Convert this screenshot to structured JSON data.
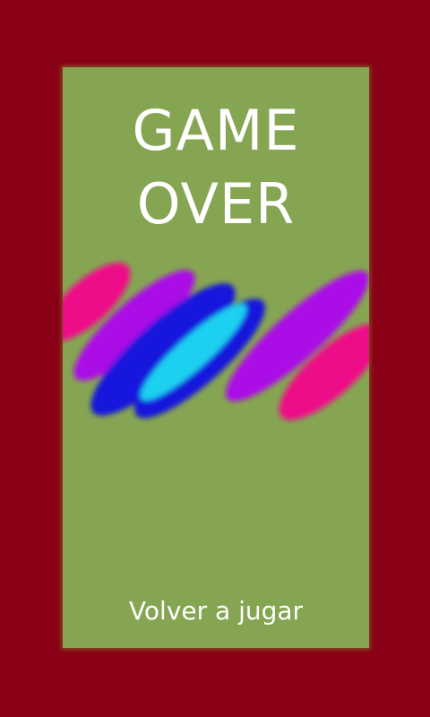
{
  "screen": {
    "title_line1": "GAME",
    "title_line2": "OVER",
    "retry_label": "Volver a jugar"
  },
  "colors": {
    "outer_background": "#8a0016",
    "panel_background": "#86a552",
    "text": "#ffffff",
    "pink": "#ee1088",
    "violet": "#aa10e6",
    "blue": "#1416dc",
    "cyan": "#1ad0f0"
  }
}
